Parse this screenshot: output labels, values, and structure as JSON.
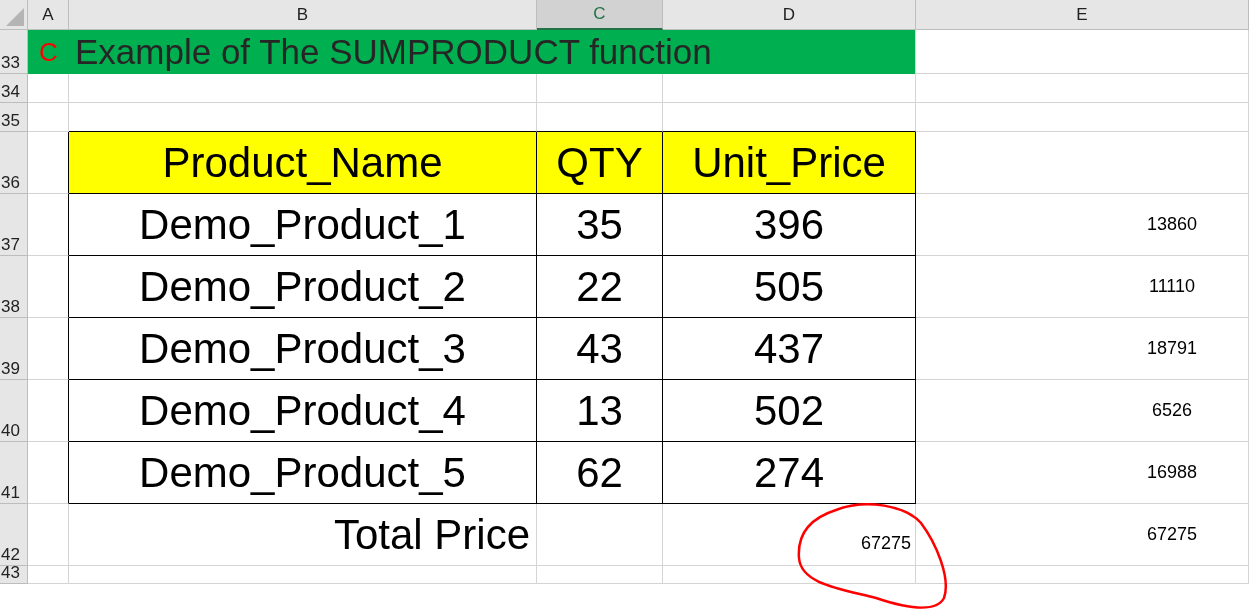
{
  "columns": [
    {
      "label": "A",
      "selected": false
    },
    {
      "label": "B",
      "selected": false
    },
    {
      "label": "C",
      "selected": true
    },
    {
      "label": "D",
      "selected": false
    },
    {
      "label": "E",
      "selected": false
    }
  ],
  "row_numbers": [
    "33",
    "34",
    "35",
    "36",
    "37",
    "38",
    "39",
    "40",
    "41",
    "42",
    "43"
  ],
  "title": {
    "marker": "C",
    "text": "Example of The SUMPRODUCT function"
  },
  "table": {
    "columns": [
      "Product_Name",
      "QTY",
      "Unit_Price"
    ],
    "rows": [
      {
        "cells": [
          "Demo_Product_1",
          "35",
          "396"
        ],
        "column_e": "13860"
      },
      {
        "cells": [
          "Demo_Product_2",
          "22",
          "505"
        ],
        "column_e": "11110"
      },
      {
        "cells": [
          "Demo_Product_3",
          "43",
          "437"
        ],
        "column_e": "18791"
      },
      {
        "cells": [
          "Demo_Product_4",
          "13",
          "502"
        ],
        "column_e": "6526"
      },
      {
        "cells": [
          "Demo_Product_5",
          "62",
          "274"
        ],
        "column_e": "16988"
      }
    ]
  },
  "total": {
    "label": "Total Price",
    "value": "67275",
    "column_e": "67275",
    "circled": true
  }
}
